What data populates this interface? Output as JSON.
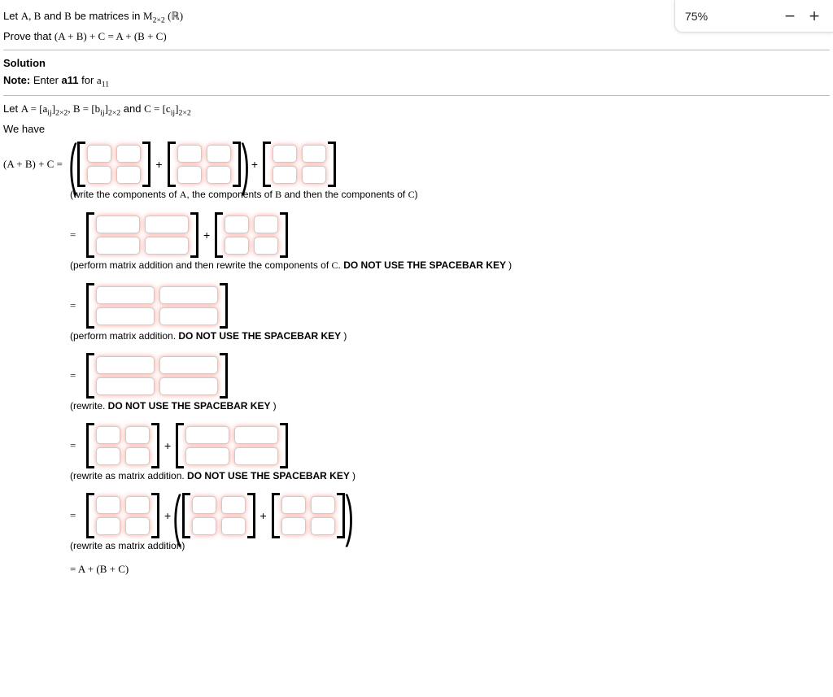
{
  "zoom": {
    "percent": "75%",
    "minus": "−",
    "plus": "+"
  },
  "problem_l1_a": "Let ",
  "problem_l1_b": "A, B",
  "problem_l1_c": " and ",
  "problem_l1_d": "B",
  "problem_l1_e": " be matrices in ",
  "problem_l1_f": "M",
  "problem_l1_g": "2×2",
  "problem_l1_h": " (ℝ)",
  "problem_l2_a": "Prove that ",
  "problem_l2_b": "(A + B) + C = A + (B + C)",
  "solution_h": "Solution",
  "note_a": "Note:",
  "note_b": " Enter ",
  "note_c": "a11",
  "note_d": " for ",
  "note_e": "a",
  "note_f": "11",
  "let_a": "Let ",
  "let_b": "A = [a",
  "let_c": "ij",
  "let_d": "]",
  "let_e": "2×2",
  "let_f": ", B = [b",
  "let_g": "ij",
  "let_h": "]",
  "let_i": "2×2",
  "let_j": " and ",
  "let_k": "C = [c",
  "let_l": "ij",
  "let_m": "]",
  "let_n": "2×2",
  "wehave": "We have",
  "lhs": "(A + B) + C =",
  "eq": "=",
  "plus": "+",
  "cap1_a": "(write the components of ",
  "cap1_b": "A",
  "cap1_c": ", the components of ",
  "cap1_d": "B",
  "cap1_e": " and then the components of ",
  "cap1_f": "C",
  "cap1_g": ")",
  "cap2_a": "(perform matrix addition and then rewrite the components of ",
  "cap2_b": "C",
  "cap2_c": ". ",
  "cap2_d": "DO NOT USE THE SPACEBAR KEY ",
  "cap2_e": ")",
  "cap3_a": "(perform matrix addition. ",
  "cap3_b": "DO NOT USE THE SPACEBAR KEY ",
  "cap3_c": ")",
  "cap4_a": "(rewrite. ",
  "cap4_b": "DO NOT USE THE SPACEBAR KEY ",
  "cap4_c": ")",
  "cap5_a": "(rewrite as matrix addition. ",
  "cap5_b": "DO NOT USE THE SPACEBAR KEY ",
  "cap5_c": ")",
  "cap6": "(rewrite as matrix addition)",
  "final": "= A + (B + C)"
}
